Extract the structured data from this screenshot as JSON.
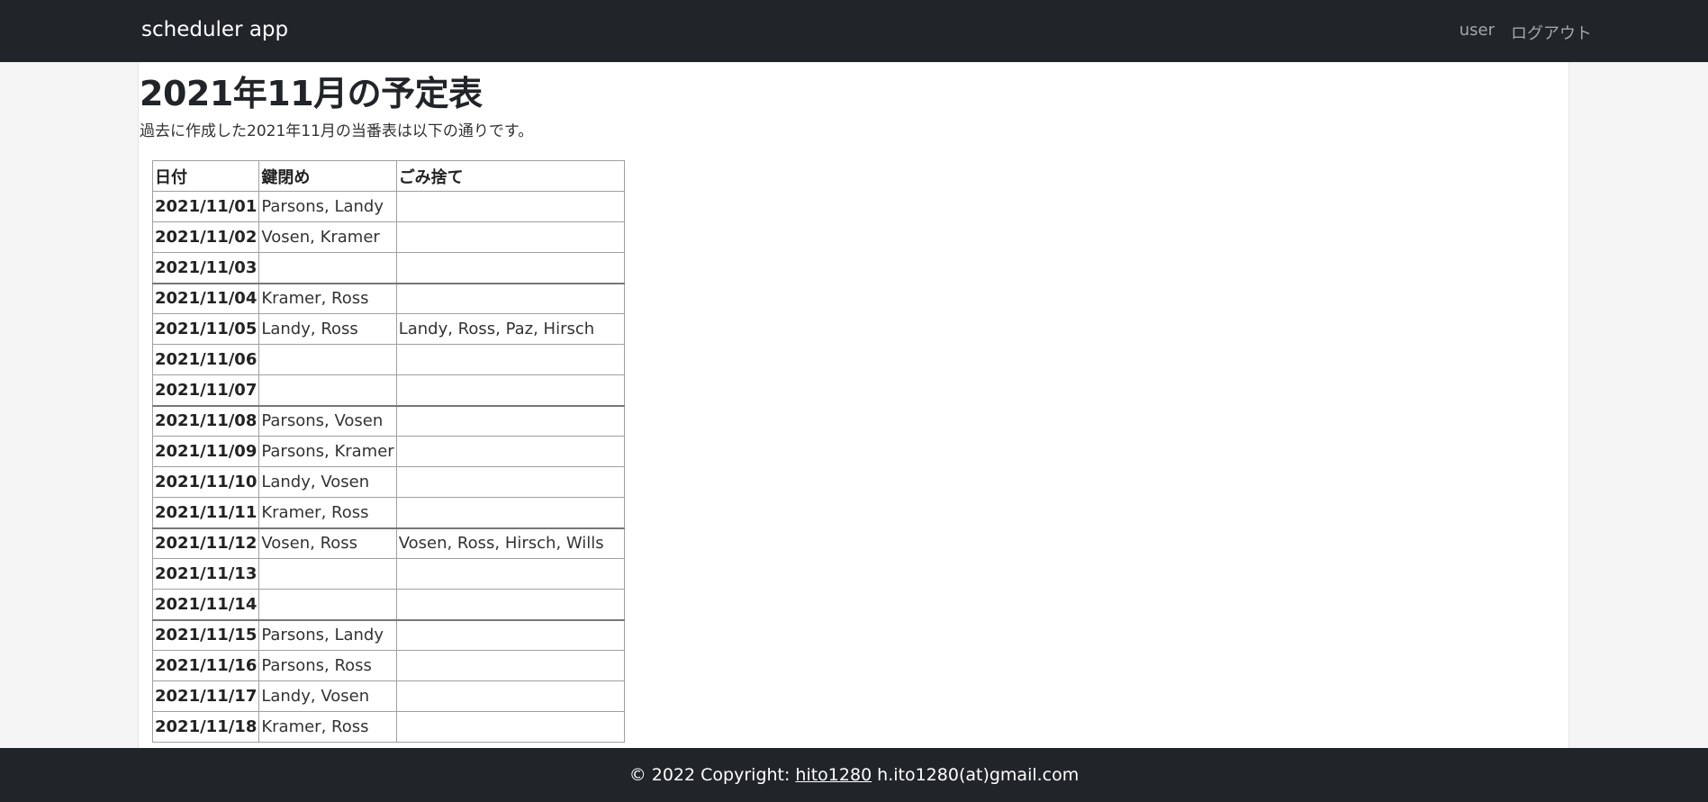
{
  "navbar": {
    "brand": "scheduler app",
    "user": "user",
    "logout": "ログアウト"
  },
  "main": {
    "title": "2021年11月の予定表",
    "description": "過去に作成した2021年11月の当番表は以下の通りです。",
    "table": {
      "headers": [
        "日付",
        "鍵閉め",
        "ごみ捨て"
      ],
      "rows": [
        {
          "date": "2021/11/01",
          "lock": "Parsons, Landy",
          "trash": ""
        },
        {
          "date": "2021/11/02",
          "lock": "Vosen, Kramer",
          "trash": ""
        },
        {
          "date": "2021/11/03",
          "lock": "",
          "trash": ""
        },
        {
          "date": "2021/11/04",
          "lock": "Kramer, Ross",
          "trash": ""
        },
        {
          "date": "2021/11/05",
          "lock": "Landy, Ross",
          "trash": "Landy, Ross, Paz, Hirsch"
        },
        {
          "date": "2021/11/06",
          "lock": "",
          "trash": ""
        },
        {
          "date": "2021/11/07",
          "lock": "",
          "trash": ""
        },
        {
          "date": "2021/11/08",
          "lock": "Parsons, Vosen",
          "trash": ""
        },
        {
          "date": "2021/11/09",
          "lock": "Parsons, Kramer",
          "trash": ""
        },
        {
          "date": "2021/11/10",
          "lock": "Landy, Vosen",
          "trash": ""
        },
        {
          "date": "2021/11/11",
          "lock": "Kramer, Ross",
          "trash": ""
        },
        {
          "date": "2021/11/12",
          "lock": "Vosen, Ross",
          "trash": "Vosen, Ross, Hirsch, Wills"
        },
        {
          "date": "2021/11/13",
          "lock": "",
          "trash": ""
        },
        {
          "date": "2021/11/14",
          "lock": "",
          "trash": ""
        },
        {
          "date": "2021/11/15",
          "lock": "Parsons, Landy",
          "trash": ""
        },
        {
          "date": "2021/11/16",
          "lock": "Parsons, Ross",
          "trash": ""
        },
        {
          "date": "2021/11/17",
          "lock": "Landy, Vosen",
          "trash": ""
        },
        {
          "date": "2021/11/18",
          "lock": "Kramer, Ross",
          "trash": ""
        }
      ]
    }
  },
  "footer": {
    "prefix": "© 2022 Copyright:",
    "link": "hito1280",
    "email": "h.ito1280(at)gmail.com"
  }
}
